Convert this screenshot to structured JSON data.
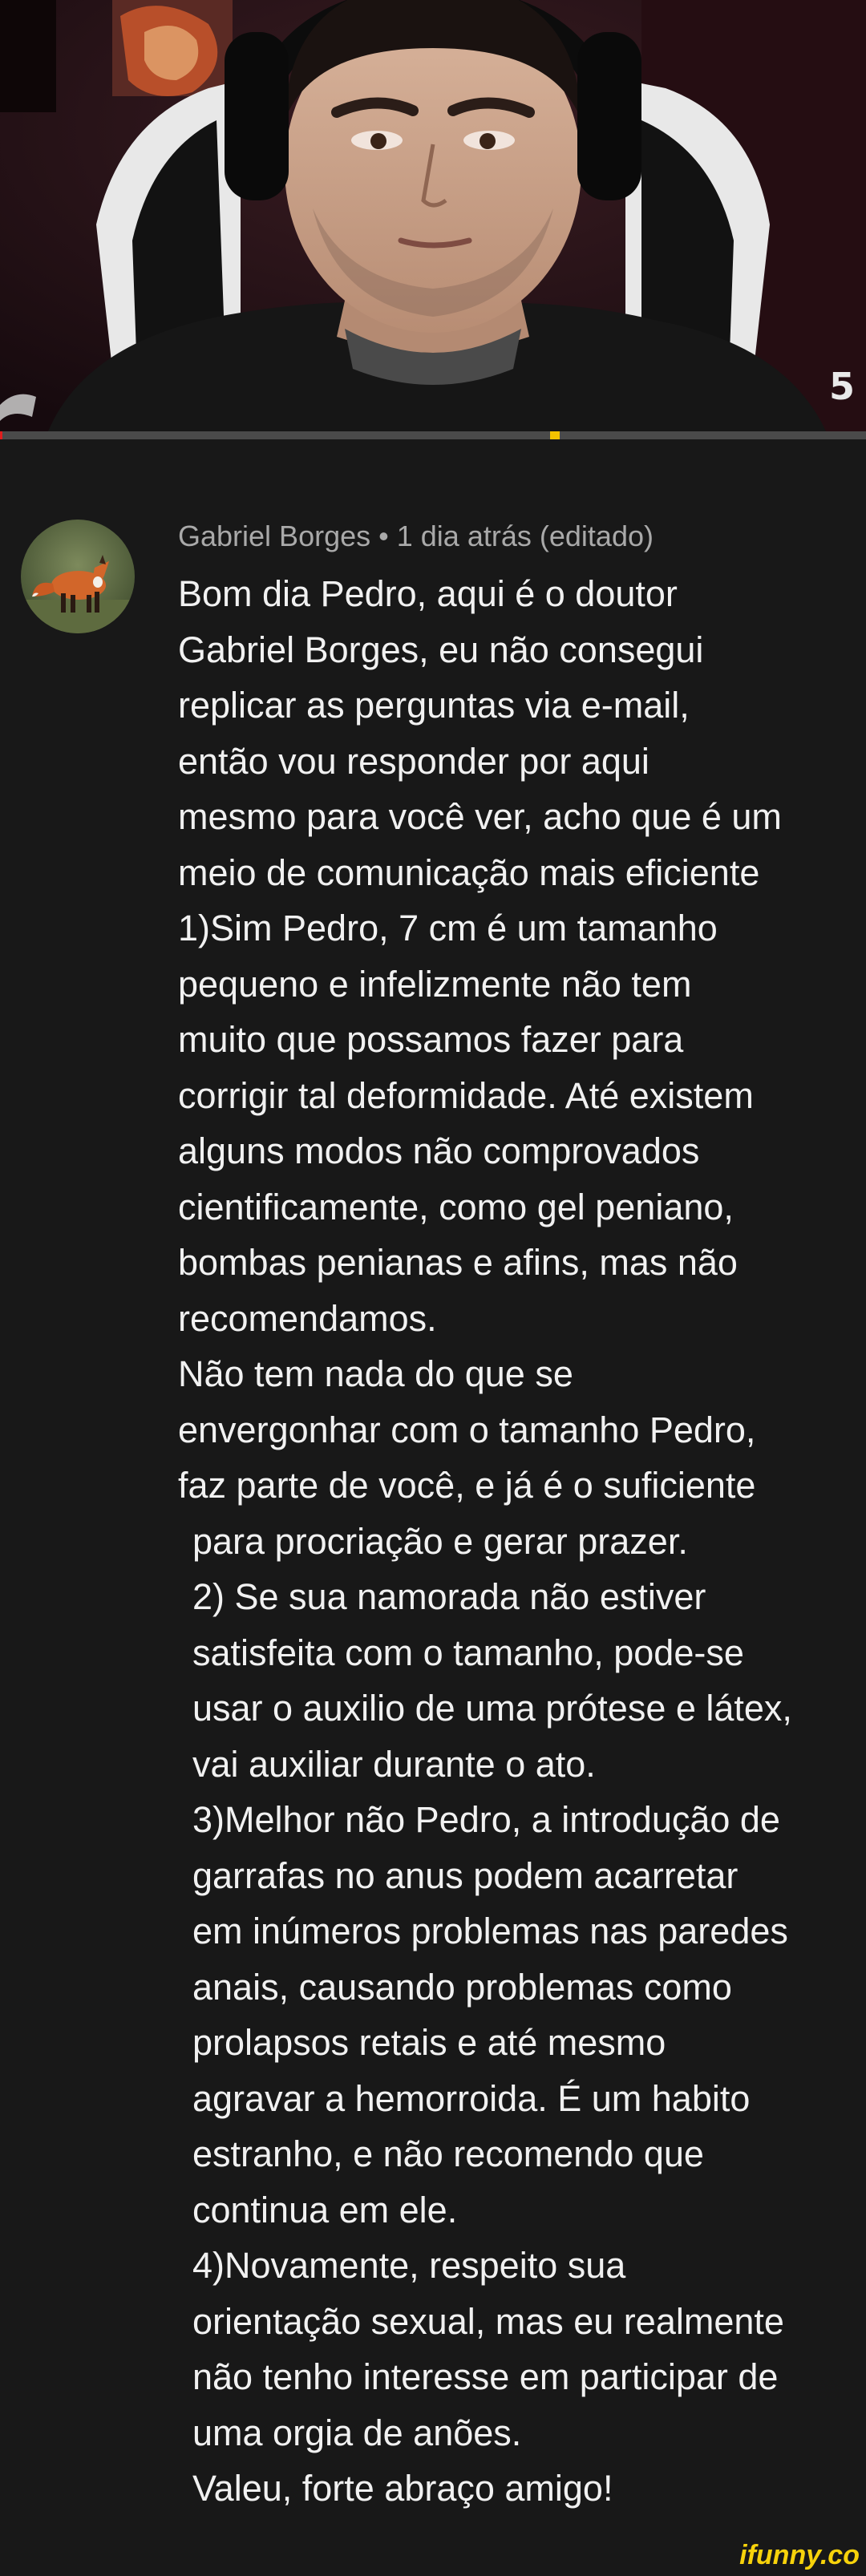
{
  "video": {
    "number_overlay": "5",
    "progress_percent": 0.3,
    "ad_marker_percent": 63.5
  },
  "comment": {
    "author": "Gabriel Borges",
    "separator": "•",
    "time": "1 dia atrás",
    "edited": "(editado)",
    "lines": [
      "Bom dia Pedro, aqui é o doutor",
      "Gabriel Borges, eu não consegui",
      "replicar as perguntas via e-mail,",
      "então vou responder por aqui",
      "mesmo para você ver, acho que é um",
      "meio de comunicação mais eficiente",
      "1)Sim Pedro, 7 cm é um tamanho",
      "pequeno e infelizmente não tem",
      "muito que possamos fazer para",
      "corrigir tal deformidade. Até existem",
      "alguns modos não comprovados",
      "cientificamente, como gel peniano,",
      "bombas penianas e afins, mas não",
      "recomendamos.",
      "Não tem nada do que se",
      "envergonhar com o tamanho Pedro,",
      "faz parte de você, e já é o suficiente",
      "para procriação e gerar prazer.",
      "2) Se sua namorada não estiver",
      "satisfeita com o tamanho, pode-se",
      "usar o auxilio de uma prótese e látex,",
      "vai auxiliar durante o ato.",
      "3)Melhor não Pedro, a introdução de",
      "garrafas no anus podem acarretar",
      "em inúmeros problemas nas paredes",
      "anais, causando problemas como",
      "prolapsos retais e até mesmo",
      "agravar a hemorroida. É um habito",
      "estranho, e não recomendo que",
      "continua em ele.",
      "4)Novamente, respeito sua",
      "orientação sexual, mas eu realmente",
      "não tenho interesse em participar de",
      "uma orgia de anões.",
      "Valeu, forte abraço amigo!"
    ]
  },
  "watermark": "ifunny.co",
  "colors": {
    "background": "#181818",
    "text_primary": "#f1f1f1",
    "text_secondary": "#a9a9a9",
    "progress_played": "#e01e1e",
    "progress_ad": "#f2c200",
    "watermark": "#f7d20b"
  }
}
